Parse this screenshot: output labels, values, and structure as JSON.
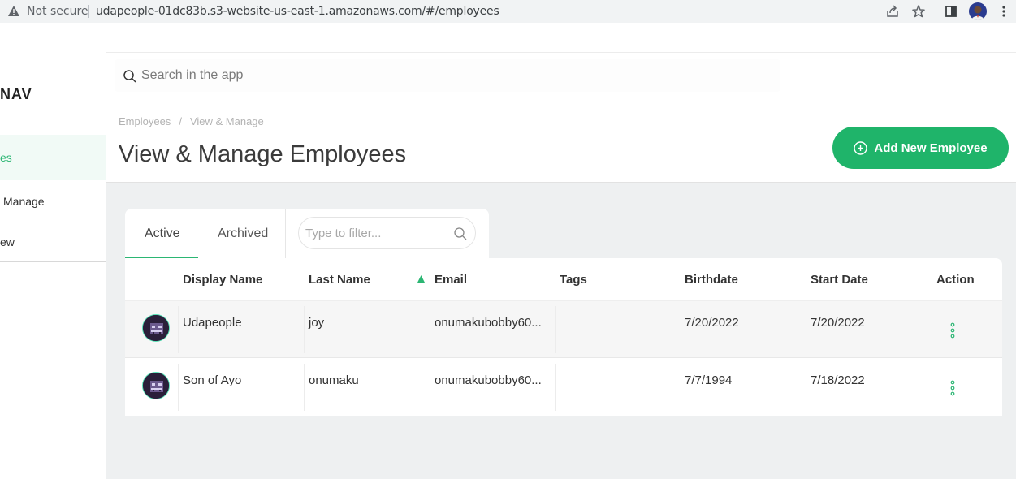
{
  "browser": {
    "security_label": "Not secure",
    "url": "udapeople-01dc83b.s3-website-us-east-1.amazonaws.com/#/employees"
  },
  "sidebar": {
    "logo": "NAV",
    "items": [
      {
        "label": "es",
        "active": true
      },
      {
        "label": "Manage",
        "active": false
      },
      {
        "label": "ew",
        "active": false
      }
    ]
  },
  "search": {
    "placeholder": "Search in the app"
  },
  "header": {
    "breadcrumb": [
      "Employees",
      "View & Manage"
    ],
    "breadcrumb_sep": "/",
    "title": "View & Manage Employees",
    "add_button": "Add New Employee"
  },
  "tabs": {
    "active": "Active",
    "archived": "Archived",
    "filter_placeholder": "Type to filter..."
  },
  "table": {
    "columns": [
      "Display Name",
      "Last Name",
      "Email",
      "Tags",
      "Birthdate",
      "Start Date",
      "Action"
    ],
    "sorted_column": "Email",
    "rows": [
      {
        "display_name": "Udapeople",
        "last_name": "joy",
        "email": "onumakubobby60...",
        "tags": "",
        "birthdate": "7/20/2022",
        "start_date": "7/20/2022"
      },
      {
        "display_name": "Son of Ayo",
        "last_name": "onumaku",
        "email": "onumakubobby60...",
        "tags": "",
        "birthdate": "7/7/1994",
        "start_date": "7/18/2022"
      }
    ]
  },
  "colors": {
    "accent": "#1fb46a",
    "text": "#333333",
    "background": "#eef0f1"
  }
}
